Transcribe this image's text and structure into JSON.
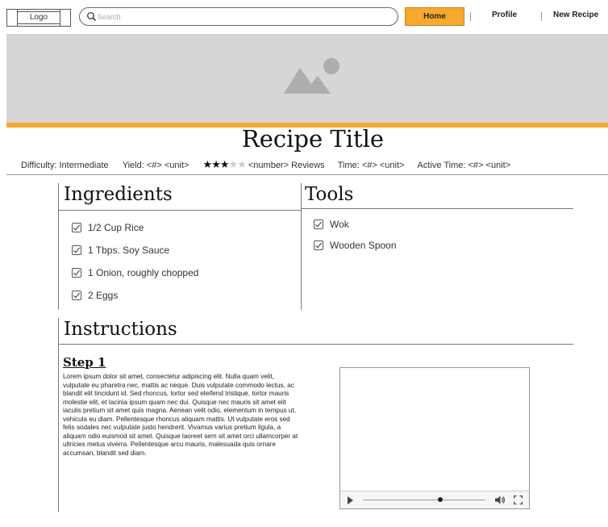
{
  "nav": {
    "logo_label": "Logo",
    "search_placeholder": "Search",
    "links": [
      "Home",
      "Profile",
      "New Recipe"
    ],
    "active": "Home",
    "accent_color": "#f7a92e"
  },
  "hero": {
    "icon": "image-placeholder-icon"
  },
  "recipe": {
    "title": "Recipe Title",
    "difficulty": "Difficulty: Intermediate",
    "yield": "Yield: <#> <unit>",
    "rating": 3,
    "rating_max": 5,
    "reviews": "<number> Reviews",
    "time": "Time: <#> <unit>",
    "active_time": "Active Time: <#> <unit>"
  },
  "ingredients": {
    "heading": "Ingredients",
    "items": [
      "1/2 Cup Rice",
      "1 Tbps. Soy Sauce",
      "1 Onion, roughly chopped",
      "2 Eggs"
    ]
  },
  "tools": {
    "heading": "Tools",
    "items": [
      "Wok",
      "Wooden Spoon"
    ]
  },
  "instructions": {
    "heading": "Instructions",
    "step_title": "Step 1",
    "step_body": "Lorem ipsum dolor sit amet, consectetur adipiscing elit. Nulla quam velit, vulputate eu pharetra nec, mattis ac neque. Duis vulputate commodo lectus, ac blandit elit tincidunt id. Sed rhoncus, tortor sed eleifend tristique, tortor mauris molestie elit, et lacinia ipsum quam nec dui. Quisque nec mauris sit amet elit iaculis pretium sit amet quis magna. Aenean velit odio, elementum in tempus ut, vehicula eu diam. Pellentesque rhoncus aliquam mattis. Ut vulputate eros sed felis sodales nec vulputate justo hendrerit. Vivamus varius pretium ligula, a aliquam odio euismod sit amet. Quisque laoreet sem sit amet orci ullamcorper at ultricies metus viverra. Pellentesque arcu mauris, malesuada quis ornare accumsan, blandit sed diam."
  },
  "video": {
    "progress": 0.63
  }
}
